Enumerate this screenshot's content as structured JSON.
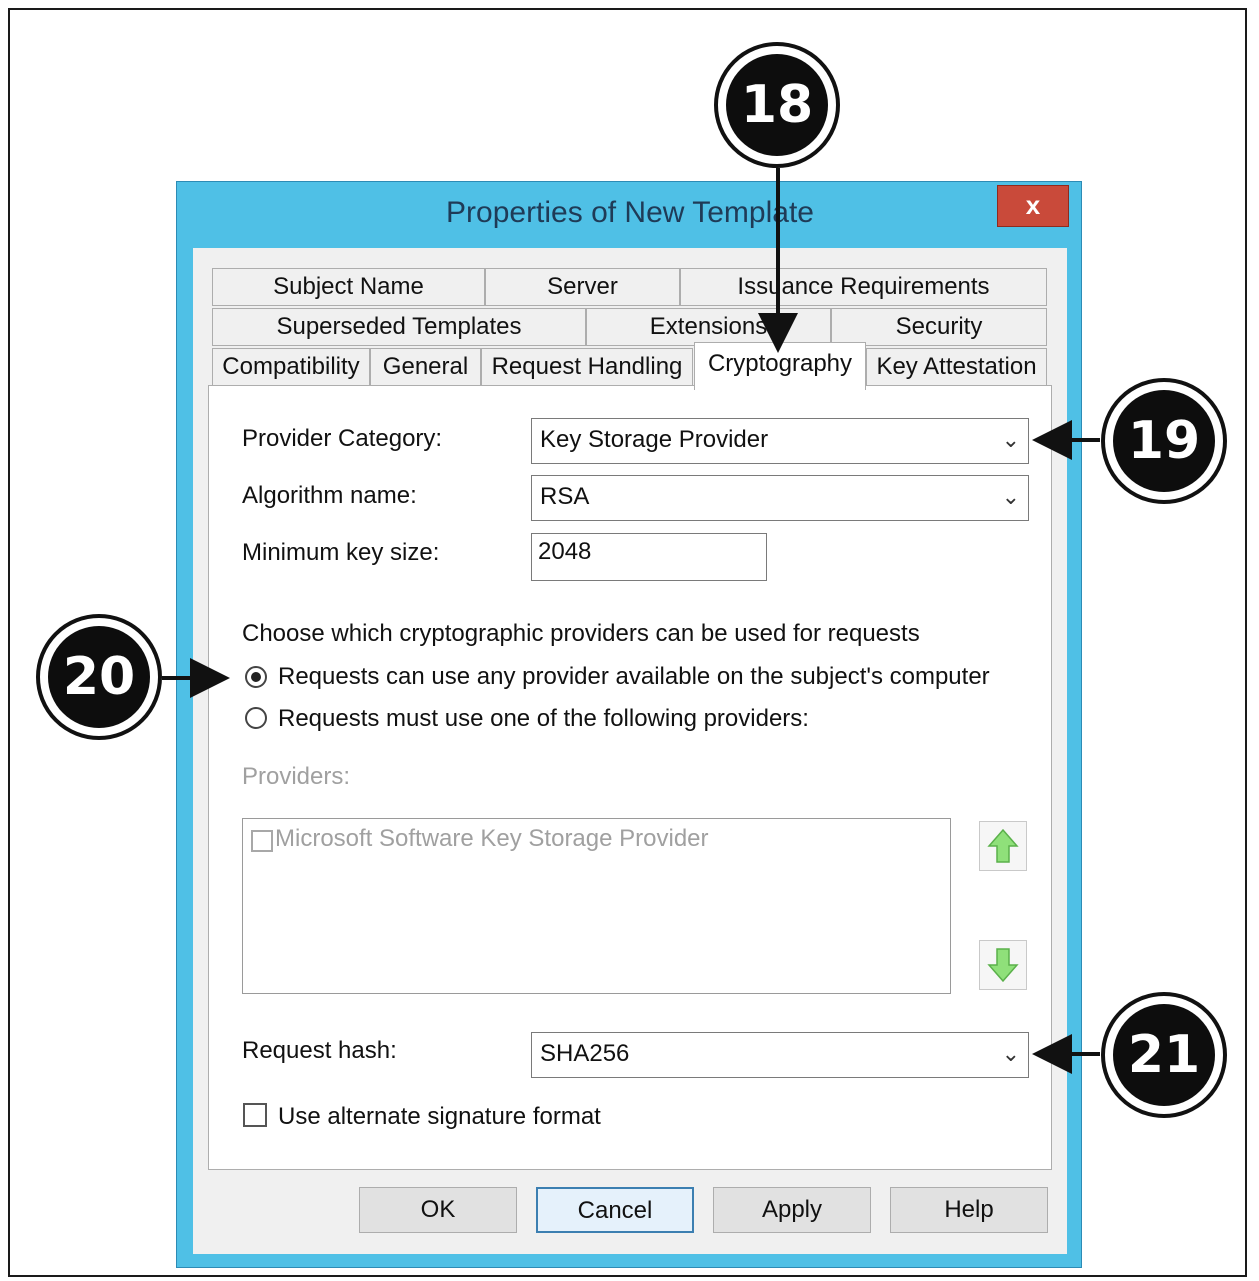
{
  "dialog": {
    "title": "Properties of New Template",
    "close_label": "x"
  },
  "tabs": {
    "row1": [
      "Subject Name",
      "Server",
      "Issuance Requirements"
    ],
    "row2": [
      "Superseded Templates",
      "Extensions",
      "Security"
    ],
    "row3": [
      "Compatibility",
      "General",
      "Request Handling",
      "Cryptography",
      "Key Attestation"
    ],
    "active": "Cryptography"
  },
  "crypto": {
    "provider_category_label": "Provider Category:",
    "provider_category_value": "Key Storage Provider",
    "algorithm_label": "Algorithm name:",
    "algorithm_value": "RSA",
    "min_key_label": "Minimum key size:",
    "min_key_value": "2048",
    "choose_text": "Choose which cryptographic providers can be used for requests",
    "radio_any": "Requests can use any provider available on the subject's computer",
    "radio_must": "Requests must use one of the following providers:",
    "radio_any_selected": true,
    "providers_label": "Providers:",
    "providers": [
      {
        "name": "Microsoft Software Key Storage Provider",
        "checked": false
      }
    ],
    "request_hash_label": "Request hash:",
    "request_hash_value": "SHA256",
    "alt_signature_label": "Use alternate signature format",
    "alt_signature_checked": false
  },
  "buttons": {
    "ok": "OK",
    "cancel": "Cancel",
    "apply": "Apply",
    "help": "Help"
  },
  "callouts": [
    "18",
    "19",
    "20",
    "21"
  ],
  "icons": {
    "chevron": "chevron-down-icon",
    "move_up": "arrow-up-icon",
    "move_down": "arrow-down-icon"
  },
  "colors": {
    "window_frame": "#4fc0e6",
    "close_button": "#c94a3a",
    "arrow_green": "#6fcf5a"
  }
}
